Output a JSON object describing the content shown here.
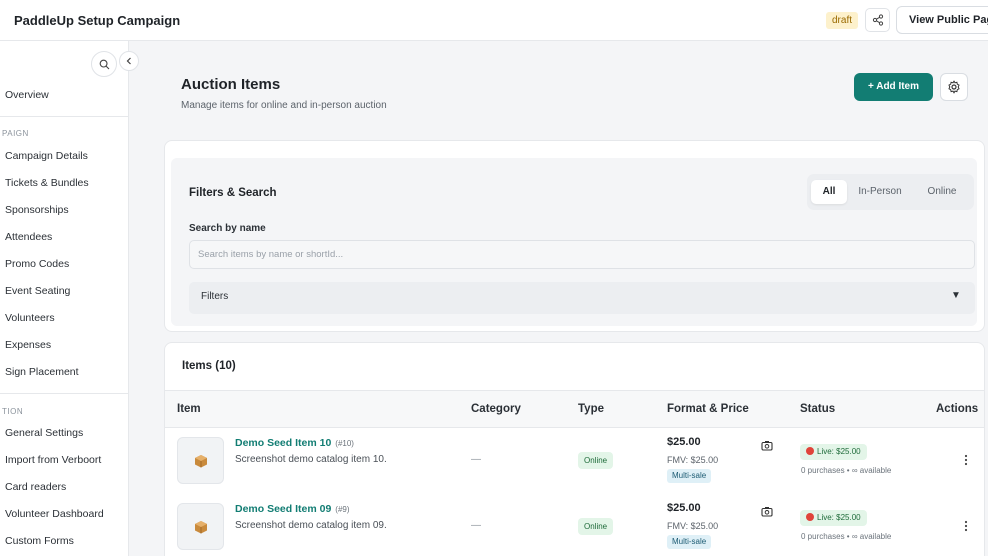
{
  "header": {
    "title": "PaddleUp Setup Campaign",
    "badge": "draft",
    "view_public_label": "View Public Page"
  },
  "sidebar": {
    "items": [
      {
        "label": "Overview"
      },
      {
        "section": "PAIGN"
      },
      {
        "label": "Campaign Details"
      },
      {
        "label": "Tickets & Bundles"
      },
      {
        "label": "Sponsorships"
      },
      {
        "label": "Attendees"
      },
      {
        "label": "Promo Codes"
      },
      {
        "label": "Event Seating"
      },
      {
        "label": "Volunteers"
      },
      {
        "label": "Expenses"
      },
      {
        "label": "Sign Placement"
      },
      {
        "section": "TION"
      },
      {
        "label": "General Settings"
      },
      {
        "label": "Import from Verboort"
      },
      {
        "label": "Card readers"
      },
      {
        "label": "Volunteer Dashboard"
      },
      {
        "label": "Custom Forms"
      }
    ]
  },
  "main": {
    "title": "Auction Items",
    "subtitle": "Manage items for online and in-person auction",
    "add_label": "+ Add Item"
  },
  "filters": {
    "title": "Filters & Search",
    "tabs": [
      {
        "label": "All",
        "active": true
      },
      {
        "label": "In-Person",
        "active": false
      },
      {
        "label": "Online",
        "active": false
      }
    ],
    "search_label": "Search by name",
    "search_placeholder": "Search items by name or shortId...",
    "filters_label": "Filters",
    "filters_arrow": "▼"
  },
  "items": {
    "title": "Items (10)",
    "columns": [
      "Item",
      "Category",
      "Type",
      "Format & Price",
      "Status",
      "Actions"
    ],
    "rows": [
      {
        "name": "Demo Seed Item 10",
        "short_id": "(#10)",
        "description": "Screenshot demo catalog item 10.",
        "category": "—",
        "type": "Online",
        "price": "$25.00",
        "fmv": "FMV: $25.00",
        "format": "Multi-sale",
        "status": "Live: $25.00",
        "purchases": "0 purchases • ∞ available"
      },
      {
        "name": "Demo Seed Item 09",
        "short_id": "(#9)",
        "description": "Screenshot demo catalog item 09.",
        "category": "—",
        "type": "Online",
        "price": "$25.00",
        "fmv": "FMV: $25.00",
        "format": "Multi-sale",
        "status": "Live: $25.00",
        "purchases": "0 purchases • ∞ available"
      }
    ]
  },
  "colors": {
    "accent": "#127d73",
    "draft_badge_bg": "#fdf1cc",
    "live_dot": "#e0443a"
  }
}
